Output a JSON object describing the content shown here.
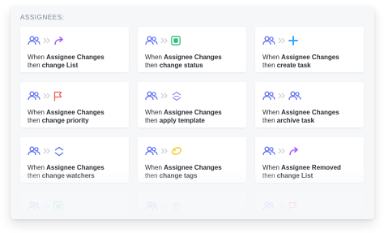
{
  "section_label": "ASSIGNEES:",
  "colors": {
    "users": "#5b6ef5",
    "chevron": "#c9ccd3",
    "list_arrow": "#a259ff",
    "status": "#2ec07a",
    "create": "#3aa7f5",
    "flag": "#f45b5b",
    "template": "#9b87f5",
    "archive": "#5b6ef5",
    "watchers": "#5b6ef5",
    "tags": "#f5c518"
  },
  "cards": [
    {
      "icon": "arrow-share-icon",
      "w1": "When ",
      "b1": "Assignee Changes",
      "w2": "then ",
      "b2": "change List"
    },
    {
      "icon": "status-square-icon",
      "w1": "When ",
      "b1": "Assignee Changes",
      "w2": "then ",
      "b2": "change status"
    },
    {
      "icon": "plus-icon",
      "w1": "When ",
      "b1": "Assignee Changes",
      "w2": "then ",
      "b2": "create task"
    },
    {
      "icon": "flag-icon",
      "w1": "When ",
      "b1": "Assignee Changes",
      "w2": "then ",
      "b2": "change priority"
    },
    {
      "icon": "template-chevrons-icon",
      "w1": "When ",
      "b1": "Assignee Changes",
      "w2": "then ",
      "b2": "apply template"
    },
    {
      "icon": "archive-users-icon",
      "w1": "When ",
      "b1": "Assignee Changes",
      "w2": "then ",
      "b2": "archive task"
    },
    {
      "icon": "watchers-chevrons-icon",
      "w1": "When ",
      "b1": "Assignee Changes",
      "w2": "then ",
      "b2": "change watchers"
    },
    {
      "icon": "tags-icon",
      "w1": "When ",
      "b1": "Assignee Changes",
      "w2": "then ",
      "b2": "change tags"
    },
    {
      "icon": "arrow-share-icon",
      "w1": "When ",
      "b1": "Assignee Removed",
      "w2": "then ",
      "b2": "change List"
    },
    {
      "icon": "status-square-icon",
      "w1": "",
      "b1": "",
      "w2": "",
      "b2": ""
    },
    {
      "icon": "template-chevrons-icon",
      "w1": "",
      "b1": "",
      "w2": "",
      "b2": ""
    },
    {
      "icon": "flag-icon",
      "w1": "",
      "b1": "",
      "w2": "",
      "b2": ""
    }
  ]
}
